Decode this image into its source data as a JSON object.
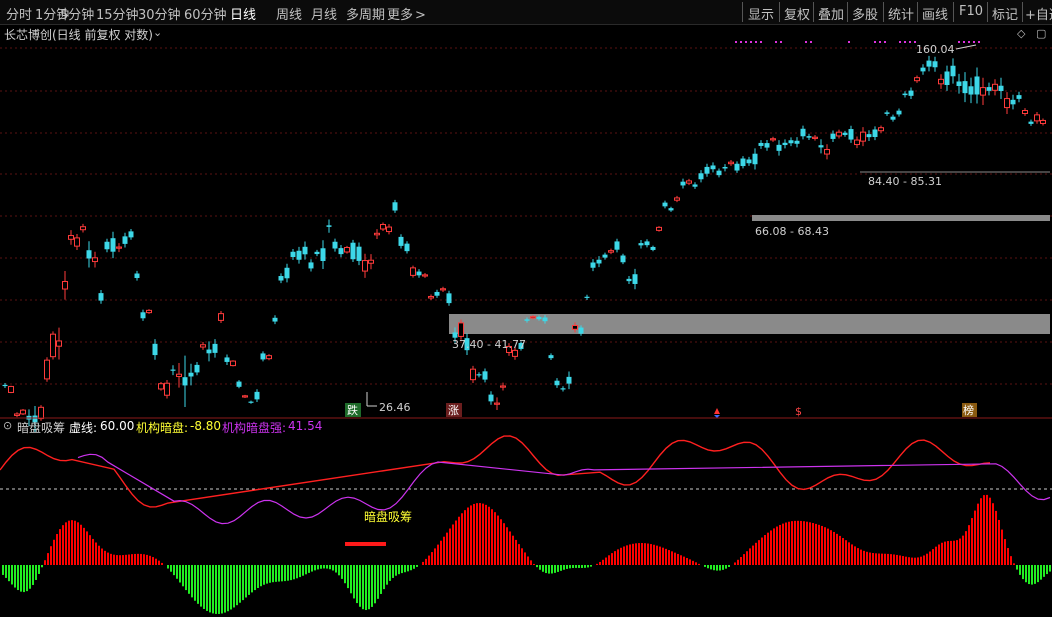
{
  "toolbar": {
    "timeframes": [
      "分时",
      "1分钟",
      "5分钟",
      "15分钟",
      "30分钟",
      "60分钟",
      "日线",
      "周线",
      "月线",
      "多周期",
      "更多"
    ],
    "active": "日线",
    "more_arrow": ">",
    "tools": [
      "显示",
      "复权",
      "叠加",
      "多股",
      "统计",
      "画线",
      "F10",
      "标记",
      "+自选"
    ]
  },
  "chart_title": "长芯博创(日线 前复权 对数)",
  "price_labels": {
    "high": "160.04",
    "low": "26.46",
    "zone1": "37.40 - 41.77",
    "zone2": "66.08 - 68.43",
    "zone3": "84.40 - 85.31"
  },
  "markers": {
    "die": "跌",
    "zhang": "涨",
    "dollar": "$",
    "bang": "榜"
  },
  "indicator": {
    "name": "暗盘吸筹",
    "label1": "虚线:",
    "value1": "60.00",
    "label2": "机构暗盘:",
    "value2": "-8.80",
    "label3": "机构暗盘强:",
    "value3": "41.54",
    "annotation": "暗盘吸筹"
  },
  "colors": {
    "up": "#ff3b3b",
    "down": "#3dd8e8",
    "hist_up": "#ff0000",
    "hist_down": "#22ee22",
    "line_red": "#ff2020",
    "line_magenta": "#cc33ee",
    "gray_zone": "#8a8a8a",
    "yellow": "#ffff33",
    "magenta_dots": "#dd33dd"
  },
  "chart_data": {
    "type": "candlestick",
    "close": [
      27,
      23,
      23,
      23,
      29,
      34,
      45,
      59,
      62,
      53,
      44,
      56,
      57,
      59,
      48,
      40,
      32,
      27,
      29,
      28,
      29,
      33,
      33,
      38,
      31,
      27,
      25,
      26,
      31,
      39,
      48,
      54,
      55,
      50,
      55,
      62,
      56,
      56,
      54,
      52,
      59,
      63,
      69,
      57,
      50,
      48,
      44,
      44,
      43,
      36,
      33,
      29,
      28,
      25,
      27,
      32,
      34,
      38,
      39,
      31,
      27,
      28,
      36,
      44,
      51,
      54,
      56,
      52,
      48,
      56,
      57,
      62,
      69,
      74,
      78,
      79,
      83,
      85,
      86,
      86,
      90,
      88,
      98,
      98,
      94,
      99,
      96,
      103,
      100,
      94,
      103,
      101,
      104,
      99,
      101,
      105,
      112,
      117,
      125,
      139,
      146,
      147,
      138,
      140,
      134,
      128,
      130,
      132,
      129,
      123,
      122,
      115,
      111,
      107
    ],
    "bars": [
      [
        5,
        8,
        -1,
        0.6
      ],
      [
        11,
        4,
        8,
        0.4
      ],
      [
        17,
        7,
        2,
        0.6
      ],
      [
        23,
        7,
        5,
        0.4
      ],
      [
        29,
        20,
        -5,
        0.8
      ],
      [
        35,
        30,
        -9,
        0.8
      ],
      [
        41,
        7,
        15,
        0.8
      ],
      [
        47,
        8,
        25,
        0.9
      ],
      [
        53,
        10,
        30,
        0.7
      ],
      [
        59,
        37,
        7,
        0.9
      ],
      [
        65,
        33,
        10,
        0.8
      ],
      [
        71,
        17,
        5,
        0.8
      ],
      [
        77,
        14,
        11,
        0.7
      ],
      [
        83,
        10,
        4,
        0.7
      ],
      [
        89,
        25,
        -11,
        0.9
      ],
      [
        95,
        25,
        5,
        0.6
      ],
      [
        101,
        13,
        -10,
        0.6
      ],
      [
        107,
        15,
        -10,
        0.5
      ],
      [
        113,
        23,
        -18,
        0.7
      ],
      [
        119,
        14,
        0,
        0.7
      ],
      [
        125,
        15,
        -10,
        0.6
      ],
      [
        131,
        10,
        -8,
        0.6
      ],
      [
        137,
        11,
        -6,
        0.6
      ],
      [
        143,
        13,
        -8,
        0.5
      ],
      [
        149,
        8,
        3,
        0.4
      ],
      [
        155,
        13,
        -15,
        0.9
      ],
      [
        161,
        7,
        7,
        0.6
      ],
      [
        167,
        10,
        16,
        0.8
      ],
      [
        173,
        18,
        -1,
        0.6
      ],
      [
        179,
        35,
        3,
        0.8
      ],
      [
        185,
        60,
        -11,
        0.9
      ],
      [
        191,
        28,
        -5,
        0.8
      ],
      [
        197,
        12,
        -10,
        0.6
      ],
      [
        203,
        10,
        3,
        0.7
      ],
      [
        209,
        29,
        -5,
        0.7
      ],
      [
        215,
        20,
        -12,
        0.6
      ],
      [
        221,
        13,
        9,
        0.5
      ],
      [
        227,
        15,
        -6,
        0.5
      ],
      [
        233,
        5,
        6,
        0.4
      ],
      [
        239,
        9,
        -7,
        0.4
      ],
      [
        245,
        6,
        0,
        0.4
      ],
      [
        251,
        6,
        -1,
        0.4
      ],
      [
        257,
        13,
        -10,
        0.5
      ],
      [
        263,
        10,
        -8,
        0.5
      ],
      [
        269,
        8,
        4,
        0.5
      ],
      [
        275,
        13,
        -5,
        0.5
      ],
      [
        281,
        13,
        -6,
        0.5
      ],
      [
        287,
        17,
        -14,
        0.6
      ],
      [
        293,
        14,
        -7,
        0.5
      ],
      [
        299,
        16,
        -12,
        0.6
      ],
      [
        305,
        19,
        -10,
        0.7
      ],
      [
        311,
        13,
        -8,
        0.6
      ],
      [
        317,
        10,
        -3,
        0.5
      ],
      [
        323,
        25,
        -17,
        0.8
      ],
      [
        329,
        21,
        -2,
        0.7
      ],
      [
        335,
        13,
        -9,
        0.6
      ],
      [
        341,
        13,
        -8,
        0.6
      ],
      [
        347,
        8,
        6,
        0.5
      ],
      [
        353,
        10,
        -22,
        0.7
      ],
      [
        359,
        15,
        -19,
        0.7
      ],
      [
        365,
        19,
        14,
        0.9
      ],
      [
        371,
        19,
        4,
        0.8
      ],
      [
        377,
        15,
        2,
        0.7
      ],
      [
        383,
        10,
        6,
        0.5
      ],
      [
        389,
        12,
        6,
        0.6
      ],
      [
        395,
        10,
        -11,
        0.6
      ],
      [
        401,
        11,
        -12,
        0.6
      ],
      [
        407,
        12,
        -10,
        0.5
      ],
      [
        413,
        11,
        10,
        0.5
      ],
      [
        419,
        10,
        -5,
        0.6
      ],
      [
        425,
        9,
        0,
        0.5
      ],
      [
        431,
        10,
        2,
        0.5
      ],
      [
        437,
        11,
        -5,
        0.5
      ],
      [
        443,
        10,
        0,
        0.5
      ],
      [
        449,
        11,
        -13,
        0.6
      ],
      [
        455,
        18,
        -7,
        0.7
      ],
      [
        461,
        12,
        18,
        0.7
      ],
      [
        467,
        15,
        -16,
        0.8
      ],
      [
        473,
        12,
        14,
        0.7
      ],
      [
        479,
        10,
        -1,
        0.5
      ],
      [
        485,
        10,
        -11,
        0.7
      ],
      [
        491,
        12,
        -9,
        0.7
      ],
      [
        497,
        18,
        0,
        0.8
      ],
      [
        503,
        12,
        0,
        0.7
      ],
      [
        509,
        14,
        8,
        0.6
      ],
      [
        515,
        14,
        8,
        0.6
      ],
      [
        521,
        8,
        -8,
        0.5
      ],
      [
        527,
        9,
        -2,
        0.5
      ],
      [
        533,
        8,
        0,
        0.4
      ],
      [
        539,
        9,
        -3,
        0.4
      ],
      [
        545,
        10,
        -5,
        0.6
      ],
      [
        551,
        9,
        -4,
        0.5
      ],
      [
        557,
        11,
        -6,
        0.6
      ],
      [
        563,
        10,
        -1,
        0.5
      ],
      [
        569,
        17,
        -9,
        0.8
      ],
      [
        575,
        13,
        5,
        0.6
      ],
      [
        581,
        11,
        -8,
        0.5
      ],
      [
        587,
        10,
        -1,
        0.5
      ],
      [
        593,
        14,
        -7,
        0.6
      ],
      [
        599,
        15,
        -5,
        0.6
      ],
      [
        605,
        10,
        -4,
        0.5
      ],
      [
        611,
        10,
        2,
        0.5
      ],
      [
        617,
        11,
        -11,
        0.6
      ],
      [
        623,
        9,
        -9,
        0.5
      ],
      [
        629,
        12,
        -3,
        0.6
      ],
      [
        635,
        19,
        -13,
        0.7
      ],
      [
        641,
        13,
        -3,
        0.6
      ],
      [
        647,
        11,
        -5,
        0.5
      ],
      [
        653,
        8,
        -4,
        0.4
      ],
      [
        659,
        8,
        4,
        0.4
      ],
      [
        665,
        10,
        -5,
        0.5
      ],
      [
        671,
        9,
        -3,
        0.4
      ],
      [
        677,
        10,
        3,
        0.5
      ],
      [
        683,
        13,
        -5,
        0.6
      ],
      [
        689,
        10,
        3,
        0.5
      ],
      [
        695,
        11,
        -3,
        0.5
      ],
      [
        701,
        13,
        -8,
        0.6
      ],
      [
        707,
        13,
        -9,
        0.6
      ],
      [
        713,
        13,
        -5,
        0.6
      ],
      [
        719,
        11,
        -6,
        0.5
      ],
      [
        725,
        12,
        -2,
        0.6
      ],
      [
        731,
        11,
        2,
        0.5
      ],
      [
        737,
        10,
        -9,
        0.6
      ],
      [
        743,
        10,
        -10,
        0.6
      ],
      [
        749,
        11,
        -5,
        0.6
      ],
      [
        755,
        19,
        -14,
        0.7
      ],
      [
        761,
        12,
        -4,
        0.6
      ],
      [
        767,
        13,
        -6,
        0.6
      ],
      [
        773,
        10,
        0,
        0.5
      ],
      [
        779,
        17,
        -8,
        0.7
      ],
      [
        785,
        14,
        -3,
        0.6
      ],
      [
        791,
        12,
        -4,
        0.6
      ],
      [
        797,
        15,
        -4,
        0.6
      ],
      [
        803,
        13,
        -10,
        0.6
      ],
      [
        809,
        12,
        -2,
        0.5
      ],
      [
        815,
        11,
        0,
        0.5
      ],
      [
        821,
        21,
        -3,
        0.7
      ],
      [
        827,
        19,
        6,
        0.7
      ],
      [
        833,
        13,
        -7,
        0.6
      ],
      [
        839,
        13,
        5,
        0.5
      ],
      [
        845,
        9,
        -3,
        0.5
      ],
      [
        851,
        14,
        -14,
        0.6
      ],
      [
        857,
        15,
        6,
        0.6
      ],
      [
        863,
        18,
        12,
        0.7
      ],
      [
        869,
        16,
        -4,
        0.6
      ],
      [
        875,
        13,
        -10,
        0.6
      ],
      [
        881,
        11,
        4,
        0.5
      ],
      [
        887,
        10,
        -2,
        0.5
      ],
      [
        893,
        10,
        -4,
        0.5
      ],
      [
        899,
        11,
        -5,
        0.5
      ],
      [
        905,
        12,
        -2,
        0.5
      ],
      [
        911,
        13,
        -7,
        0.6
      ],
      [
        917,
        11,
        4,
        0.5
      ],
      [
        923,
        14,
        -5,
        0.6
      ],
      [
        929,
        17,
        -8,
        0.7
      ],
      [
        935,
        16,
        -8,
        0.7
      ],
      [
        941,
        18,
        6,
        0.7
      ],
      [
        947,
        21,
        -18,
        0.7
      ],
      [
        953,
        23,
        -14,
        0.8
      ],
      [
        959,
        24,
        -6,
        0.8
      ],
      [
        965,
        28,
        -16,
        0.8
      ],
      [
        971,
        27,
        -11,
        0.8
      ],
      [
        977,
        25,
        -24,
        0.9
      ],
      [
        983,
        31,
        10,
        0.8
      ],
      [
        989,
        16,
        -5,
        0.7
      ],
      [
        995,
        18,
        8,
        0.7
      ],
      [
        1001,
        25,
        -7,
        0.8
      ],
      [
        1007,
        20,
        12,
        0.8
      ],
      [
        1013,
        18,
        -6,
        0.7
      ],
      [
        1019,
        14,
        -5,
        0.6
      ],
      [
        1025,
        12,
        4,
        0.5
      ],
      [
        1031,
        10,
        -3,
        0.5
      ],
      [
        1037,
        12,
        8,
        0.6
      ],
      [
        1043,
        10,
        4,
        0.5
      ]
    ]
  }
}
